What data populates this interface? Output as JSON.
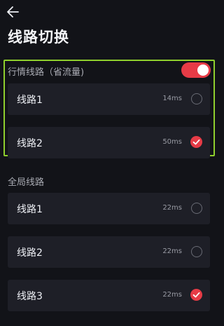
{
  "header": {
    "back_icon": "arrow-left-icon",
    "title": "线路切换"
  },
  "market_section": {
    "title": "行情线路（省流量)",
    "toggle_on": true,
    "accent_color": "#e63b46",
    "lines": [
      {
        "name": "线路1",
        "latency": "14ms",
        "selected": false
      },
      {
        "name": "线路2",
        "latency": "50ms",
        "selected": true
      }
    ]
  },
  "global_section": {
    "title": "全局线路",
    "lines": [
      {
        "name": "线路1",
        "latency": "22ms",
        "selected": false
      },
      {
        "name": "线路2",
        "latency": "22ms",
        "selected": false
      },
      {
        "name": "线路3",
        "latency": "22ms",
        "selected": true
      }
    ]
  }
}
